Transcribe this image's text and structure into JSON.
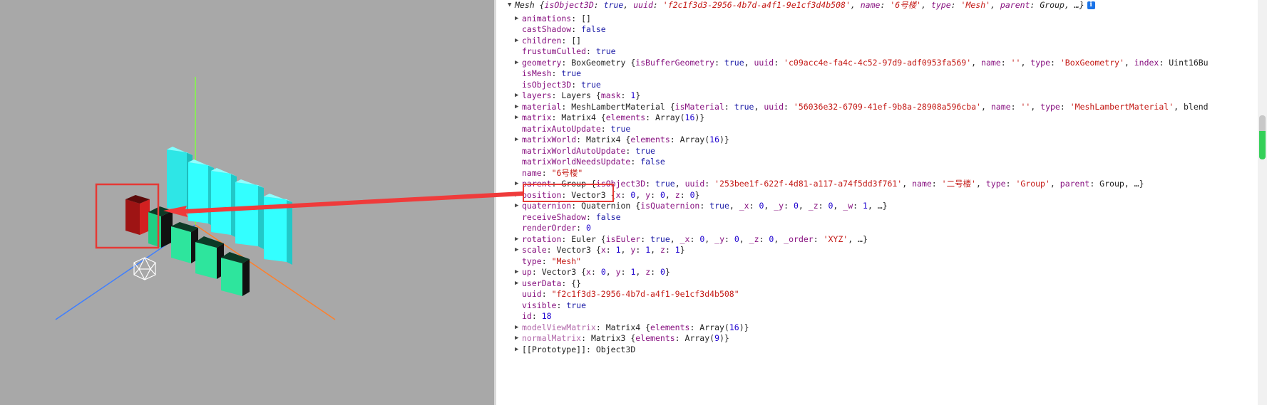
{
  "console": {
    "header": {
      "prefix": "Mesh {",
      "k1": "isObject3D",
      "v1": "true",
      "k2": "uuid",
      "v2": "'f2c1f3d3-2956-4b7d-a4f1-9e1cf3d4b508'",
      "k3": "name",
      "v3": "'6号楼'",
      "k4": "type",
      "v4": "'Mesh'",
      "k5": "parent",
      "v5": "Group, …}",
      "info": "i"
    },
    "rows": [
      {
        "expand": true,
        "key": "animations",
        "sep": ": ",
        "val": "[]",
        "cls": "punc"
      },
      {
        "expand": false,
        "key": "castShadow",
        "sep": ": ",
        "val": "false",
        "cls": "kw"
      },
      {
        "expand": true,
        "key": "children",
        "sep": ": ",
        "val": "[]",
        "cls": "punc"
      },
      {
        "expand": false,
        "key": "frustumCulled",
        "sep": ": ",
        "val": "true",
        "cls": "kw"
      },
      {
        "expand": true,
        "key": "geometry",
        "sep": ": ",
        "val": "BoxGeometry {isBufferGeometry: true, uuid: 'c09acc4e-fa4c-4c52-97d9-adf0953fa569', name: '', type: 'BoxGeometry', index: Uint16Bu",
        "cls": "rich"
      },
      {
        "expand": false,
        "key": "isMesh",
        "sep": ": ",
        "val": "true",
        "cls": "kw"
      },
      {
        "expand": false,
        "key": "isObject3D",
        "sep": ": ",
        "val": "true",
        "cls": "kw"
      },
      {
        "expand": true,
        "key": "layers",
        "sep": ": ",
        "val": "Layers {mask: 1}",
        "cls": "rich"
      },
      {
        "expand": true,
        "key": "material",
        "sep": ": ",
        "val": "MeshLambertMaterial {isMaterial: true, uuid: '56036e32-6709-41ef-9b8a-28908a596cba', name: '', type: 'MeshLambertMaterial', blend",
        "cls": "rich"
      },
      {
        "expand": true,
        "key": "matrix",
        "sep": ": ",
        "val": "Matrix4 {elements: Array(16)}",
        "cls": "rich"
      },
      {
        "expand": false,
        "key": "matrixAutoUpdate",
        "sep": ": ",
        "val": "true",
        "cls": "kw"
      },
      {
        "expand": true,
        "key": "matrixWorld",
        "sep": ": ",
        "val": "Matrix4 {elements: Array(16)}",
        "cls": "rich"
      },
      {
        "expand": false,
        "key": "matrixWorldAutoUpdate",
        "sep": ": ",
        "val": "true",
        "cls": "kw"
      },
      {
        "expand": false,
        "key": "matrixWorldNeedsUpdate",
        "sep": ": ",
        "val": "false",
        "cls": "kw"
      },
      {
        "expand": false,
        "key": "name",
        "sep": ": ",
        "val": "\"6号楼\"",
        "cls": "str"
      },
      {
        "expand": true,
        "key": "parent",
        "sep": ": ",
        "val": "Group {isObject3D: true, uuid: '253bee1f-622f-4d81-a117-a74f5dd3f761', name: '二号楼', type: 'Group', parent: Group, …}",
        "cls": "rich"
      },
      {
        "expand": true,
        "key": "position",
        "sep": ": ",
        "val": "Vector3 {x: 0, y: 0, z: 0}",
        "cls": "rich"
      },
      {
        "expand": true,
        "key": "quaternion",
        "sep": ": ",
        "val": "Quaternion {isQuaternion: true, _x: 0, _y: 0, _z: 0, _w: 1, …}",
        "cls": "rich"
      },
      {
        "expand": false,
        "key": "receiveShadow",
        "sep": ": ",
        "val": "false",
        "cls": "kw"
      },
      {
        "expand": false,
        "key": "renderOrder",
        "sep": ": ",
        "val": "0",
        "cls": "num"
      },
      {
        "expand": true,
        "key": "rotation",
        "sep": ": ",
        "val": "Euler {isEuler: true, _x: 0, _y: 0, _z: 0, _order: 'XYZ', …}",
        "cls": "rich"
      },
      {
        "expand": true,
        "key": "scale",
        "sep": ": ",
        "val": "Vector3 {x: 1, y: 1, z: 1}",
        "cls": "rich"
      },
      {
        "expand": false,
        "key": "type",
        "sep": ": ",
        "val": "\"Mesh\"",
        "cls": "str"
      },
      {
        "expand": true,
        "key": "up",
        "sep": ": ",
        "val": "Vector3 {x: 0, y: 1, z: 0}",
        "cls": "rich"
      },
      {
        "expand": true,
        "key": "userData",
        "sep": ": ",
        "val": "{}",
        "cls": "punc"
      },
      {
        "expand": false,
        "key": "uuid",
        "sep": ": ",
        "val": "\"f2c1f3d3-2956-4b7d-a4f1-9e1cf3d4b508\"",
        "cls": "str"
      },
      {
        "expand": false,
        "key": "visible",
        "sep": ": ",
        "val": "true",
        "cls": "kw"
      },
      {
        "expand": false,
        "key": "id",
        "sep": ": ",
        "val": "18",
        "cls": "num"
      },
      {
        "expand": true,
        "key": "modelViewMatrix",
        "sep": ": ",
        "val": "Matrix4 {elements: Array(16)}",
        "cls": "rich",
        "dim": true
      },
      {
        "expand": true,
        "key": "normalMatrix",
        "sep": ": ",
        "val": "Matrix3 {elements: Array(9)}",
        "cls": "rich",
        "dim": true
      },
      {
        "expand": true,
        "key": "[[Prototype]]",
        "sep": ": ",
        "val": "Object3D",
        "cls": "punc",
        "proto": true
      }
    ]
  },
  "colors": {
    "viewport_bg": "#a8a8a8",
    "highlight": "#e53935",
    "selected_mesh": "#b71c1c",
    "green_mesh": "#2ee59d",
    "cyan_mesh": "#33ffff",
    "axis_x": "#ff7f2a",
    "axis_y": "#7fff3f",
    "axis_z": "#3f7fff"
  }
}
